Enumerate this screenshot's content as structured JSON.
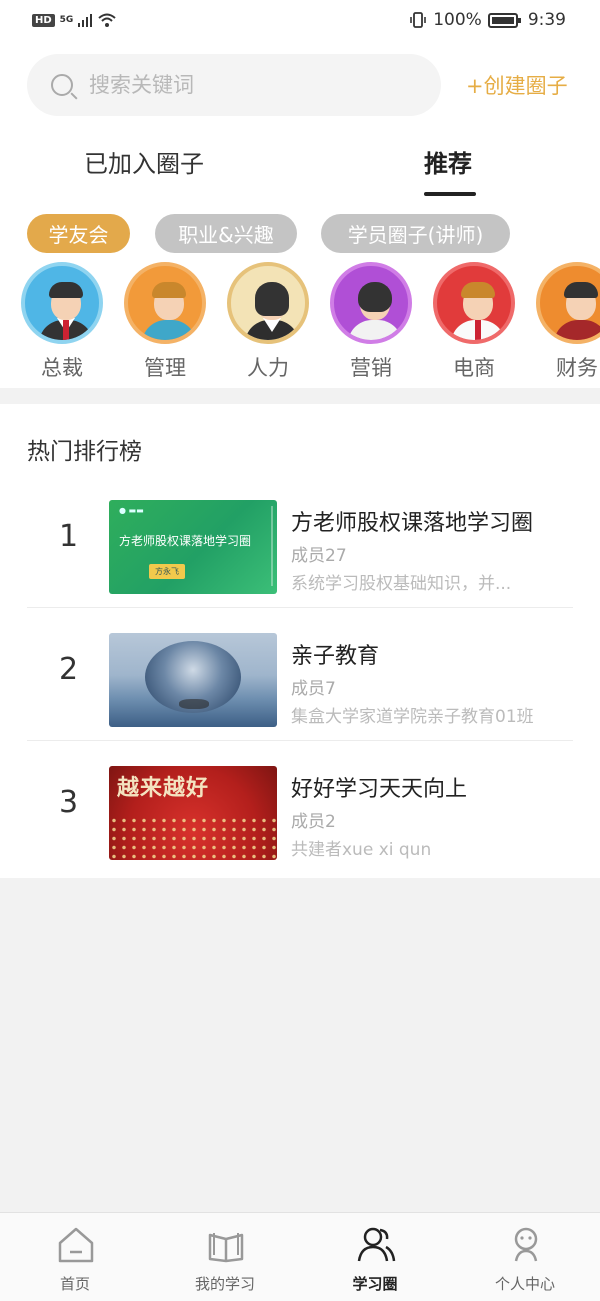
{
  "status_bar": {
    "hd": "HD",
    "network": "5G",
    "battery_pct": "100%",
    "time": "9:39"
  },
  "search": {
    "placeholder": "搜索关键词",
    "create_label": "+创建圈子"
  },
  "tabs": [
    {
      "label": "已加入圈子",
      "active": false
    },
    {
      "label": "推荐",
      "active": true
    }
  ],
  "chips": [
    {
      "label": "学友会",
      "active": true
    },
    {
      "label": "职业&兴趣",
      "active": false
    },
    {
      "label": "学员圈子(讲师)",
      "active": false
    }
  ],
  "categories": [
    {
      "label": "总裁",
      "icon": "ceo-avatar-icon",
      "ring": "#8fd4f0",
      "fill": "#4fb6e6"
    },
    {
      "label": "管理",
      "icon": "manager-avatar-icon",
      "ring": "#f4b266",
      "fill": "#f29a3a"
    },
    {
      "label": "人力",
      "icon": "hr-avatar-icon",
      "ring": "#e6c27a",
      "fill": "#f3e3b6"
    },
    {
      "label": "营销",
      "icon": "marketing-avatar-icon",
      "ring": "#d07de6",
      "fill": "#b04fd6"
    },
    {
      "label": "电商",
      "icon": "ecommerce-avatar-icon",
      "ring": "#ef6a6a",
      "fill": "#e13b3b"
    },
    {
      "label": "财务",
      "icon": "finance-avatar-icon",
      "ring": "#f4b266",
      "fill": "#ee8c2f"
    }
  ],
  "ranking": {
    "title": "热门排行榜",
    "items": [
      {
        "rank": "1",
        "name": "方老师股权课落地学习圈",
        "members": "成员27",
        "desc": "系统学习股权基础知识，并...",
        "thumb_title": "方老师股权课落地学习圈",
        "thumb_tag": "方永飞"
      },
      {
        "rank": "2",
        "name": "亲子教育",
        "members": "成员7",
        "desc": "集盒大学家道学院亲子教育01班"
      },
      {
        "rank": "3",
        "name": "好好学习天天向上",
        "members": "成员2",
        "desc": "共建者xue xi qun",
        "thumb_title": "越来越好"
      }
    ]
  },
  "nav": [
    {
      "label": "首页",
      "icon": "home-icon",
      "active": false
    },
    {
      "label": "我的学习",
      "icon": "book-icon",
      "active": false
    },
    {
      "label": "学习圈",
      "icon": "community-icon",
      "active": true
    },
    {
      "label": "个人中心",
      "icon": "profile-icon",
      "active": false
    }
  ]
}
